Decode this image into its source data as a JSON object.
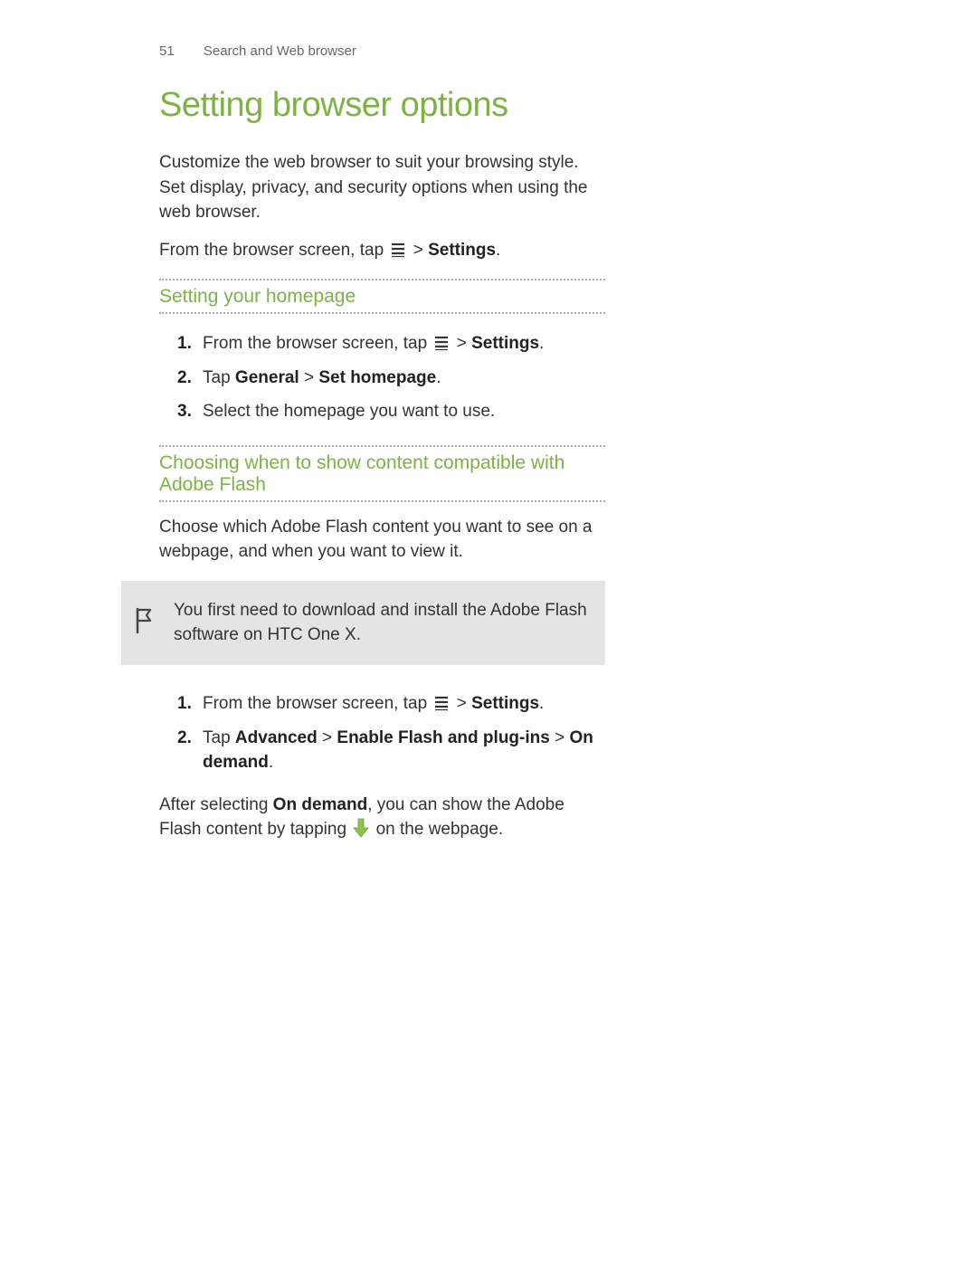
{
  "header": {
    "page_number": "51",
    "section": "Search and Web browser"
  },
  "title": "Setting browser options",
  "intro": "Customize the web browser to suit your browsing style. Set display, privacy, and security options when using the web browser.",
  "instruction_line": {
    "pre": "From the browser screen, tap ",
    "post_icon": " > ",
    "settings": "Settings",
    "period": "."
  },
  "section1": {
    "heading": "Setting your homepage",
    "steps": {
      "s1_pre": "From the browser screen, tap ",
      "s1_post": " > ",
      "s1_settings": "Settings",
      "s1_period": ".",
      "s2_pre": "Tap ",
      "s2_general": "General",
      "s2_gt": " > ",
      "s2_homepage": "Set homepage",
      "s2_period": ".",
      "s3": "Select the homepage you want to use."
    }
  },
  "section2": {
    "heading": "Choosing when to show content compatible with Adobe Flash",
    "intro": "Choose which Adobe Flash content you want to see on a webpage, and when you want to view it.",
    "note": "You first need to download and install the Adobe Flash software on HTC One X.",
    "steps": {
      "s1_pre": "From the browser screen, tap ",
      "s1_post": " > ",
      "s1_settings": "Settings",
      "s1_period": ".",
      "s2_pre": "Tap ",
      "s2_advanced": "Advanced",
      "s2_gt1": " > ",
      "s2_enable": "Enable Flash and plug-ins",
      "s2_gt2": " > ",
      "s2_ondemand": "On demand",
      "s2_period": "."
    },
    "after": {
      "pre": "After selecting ",
      "ondemand": "On demand",
      "mid": ", you can show the Adobe Flash content by tapping ",
      "post": " on the webpage."
    }
  }
}
